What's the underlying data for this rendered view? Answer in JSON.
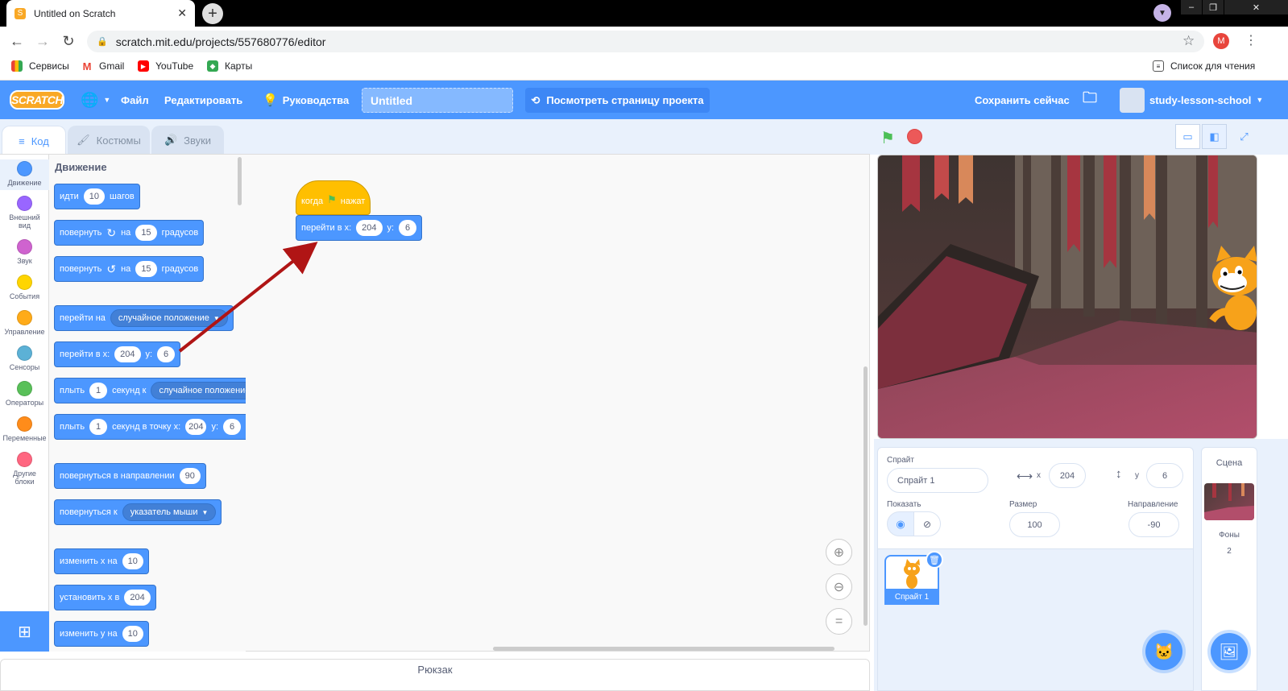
{
  "browser": {
    "tab_title": "Untitled on Scratch",
    "url": "scratch.mit.edu/projects/557680776/editor",
    "profile_initial": "M",
    "bookmarks": [
      "Сервисы",
      "Gmail",
      "YouTube",
      "Карты"
    ],
    "reading_list": "Список для чтения"
  },
  "menu": {
    "logo": "SCRATCH",
    "file": "Файл",
    "edit": "Редактировать",
    "tutorials": "Руководства",
    "project_title": "Untitled",
    "see_project": "Посмотреть страницу проекта",
    "save_now": "Сохранить сейчас",
    "username": "study-lesson-school"
  },
  "tabs": {
    "code": "Код",
    "costumes": "Костюмы",
    "sounds": "Звуки"
  },
  "categories": [
    {
      "label": "Движение",
      "color": "#4c97ff"
    },
    {
      "label": "Внешний вид",
      "color": "#9966ff"
    },
    {
      "label": "Звук",
      "color": "#cf63cf"
    },
    {
      "label": "События",
      "color": "#ffd500"
    },
    {
      "label": "Управление",
      "color": "#ffab19"
    },
    {
      "label": "Сенсоры",
      "color": "#5cb1d6"
    },
    {
      "label": "Операторы",
      "color": "#59c059"
    },
    {
      "label": "Переменные",
      "color": "#ff8c1a"
    },
    {
      "label": "Другие блоки",
      "color": "#ff6680"
    }
  ],
  "palette": {
    "title": "Движение",
    "move": {
      "t1": "идти",
      "v": "10",
      "t2": "шагов"
    },
    "turn_right": {
      "t1": "повернуть",
      "t2": "на",
      "v": "15",
      "t3": "градусов"
    },
    "turn_left": {
      "t1": "повернуть",
      "t2": "на",
      "v": "15",
      "t3": "градусов"
    },
    "goto": {
      "t1": "перейти на",
      "dd": "случайное положение"
    },
    "gotoxy": {
      "t1": "перейти в x:",
      "x": "204",
      "t2": "y:",
      "y": "6"
    },
    "glide": {
      "t1": "плыть",
      "v": "1",
      "t2": "секунд к",
      "dd": "случайное положение"
    },
    "glidexy": {
      "t1": "плыть",
      "v": "1",
      "t2": "секунд в точку x:",
      "x": "204",
      "t3": "y:",
      "y": "6"
    },
    "point_dir": {
      "t1": "повернуться в направлении",
      "v": "90"
    },
    "point_towards": {
      "t1": "повернуться к",
      "dd": "указатель мыши"
    },
    "change_x": {
      "t1": "изменить х на",
      "v": "10"
    },
    "set_x": {
      "t1": "установить х в",
      "v": "204"
    },
    "change_y": {
      "t1": "изменить у на",
      "v": "10"
    }
  },
  "script": {
    "hat": {
      "t1": "когда",
      "t2": "нажат"
    },
    "gotoxy": {
      "t1": "перейти в x:",
      "x": "204",
      "t2": "y:",
      "y": "6"
    }
  },
  "backpack": "Рюкзак",
  "sprite": {
    "label": "Спрайт",
    "name": "Спрайт 1",
    "x_label": "x",
    "x": "204",
    "y_label": "y",
    "y": "6",
    "show_label": "Показать",
    "size_label": "Размер",
    "size": "100",
    "direction_label": "Направление",
    "direction": "-90",
    "thumb_label": "Спрайт 1"
  },
  "stage_panel": {
    "title": "Сцена",
    "backdrops_label": "Фоны",
    "backdrops_count": "2"
  }
}
